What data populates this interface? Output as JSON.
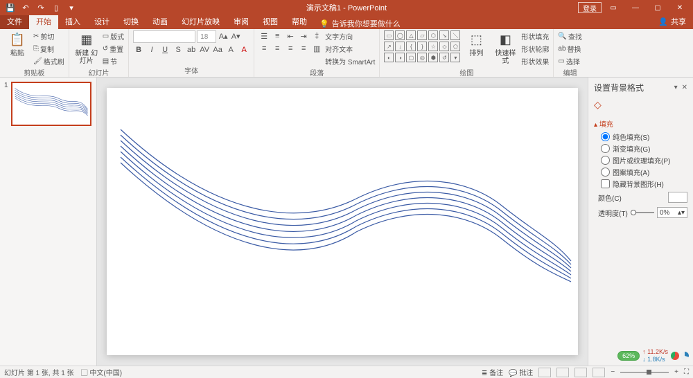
{
  "titlebar": {
    "title": "演示文稿1 - PowerPoint",
    "login": "登录",
    "share_label": "共享"
  },
  "tabs": {
    "file": "文件",
    "items": [
      "开始",
      "插入",
      "设计",
      "切换",
      "动画",
      "幻灯片放映",
      "审阅",
      "视图",
      "帮助"
    ],
    "tell": "告诉我你想要做什么"
  },
  "ribbon": {
    "clipboard": {
      "label": "剪贴板",
      "paste": "粘贴",
      "cut": "剪切",
      "copy": "复制",
      "fmt": "格式刷"
    },
    "slides": {
      "label": "幻灯片",
      "new": "新建\n幻灯片",
      "layout": "版式",
      "reset": "重置",
      "section": "节"
    },
    "font": {
      "label": "字体",
      "size": "18"
    },
    "paragraph": {
      "label": "段落",
      "dir": "文字方向",
      "align": "对齐文本",
      "smart": "转换为 SmartArt"
    },
    "drawing": {
      "label": "绘图",
      "arrange": "排列",
      "quick": "快速样式",
      "fill": "形状填充",
      "outline": "形状轮廓",
      "effect": "形状效果"
    },
    "editing": {
      "label": "编辑",
      "find": "查找",
      "replace": "替换",
      "select": "选择"
    }
  },
  "sidepanel": {
    "title": "设置背景格式",
    "section": "填充",
    "opts": {
      "solid": "纯色填充(S)",
      "gradient": "渐变填充(G)",
      "picture": "图片或纹理填充(P)",
      "pattern": "图案填充(A)",
      "hide": "隐藏背景图形(H)"
    },
    "color_label": "颜色(C)",
    "trans_label": "透明度(T)",
    "trans_value": "0%"
  },
  "status": {
    "slide": "幻灯片 第 1 张, 共 1 张",
    "lang": "中文(中国)",
    "notes": "备注",
    "comments": "批注",
    "zoom": "62%",
    "net1": "11.2K/s",
    "net2": "1.8K/s"
  },
  "thumb": {
    "num": "1"
  }
}
